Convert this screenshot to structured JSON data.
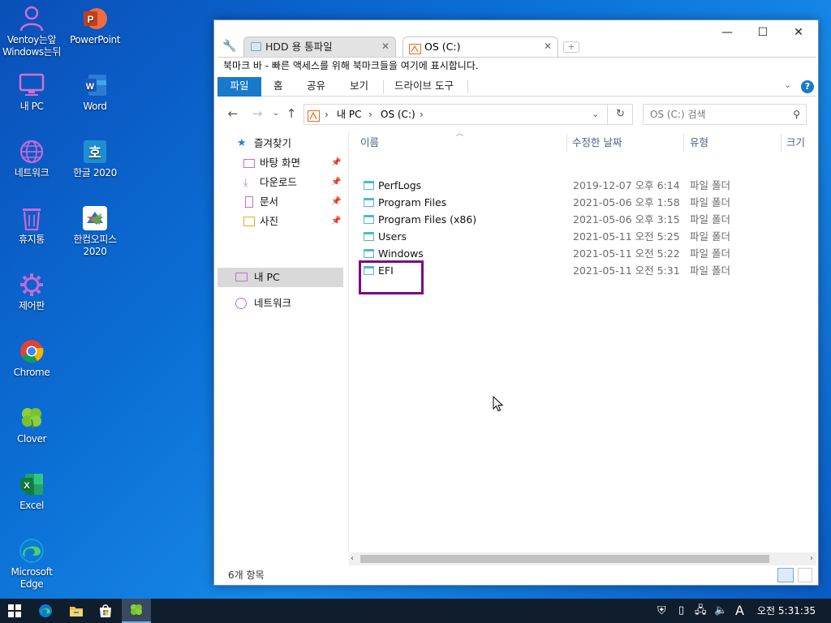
{
  "desktop": {
    "icons": [
      {
        "label": "Ventoy는앞\nWindows는뒤",
        "icon": "user-icon"
      },
      {
        "label": "PowerPoint",
        "icon": "powerpoint-icon"
      },
      {
        "label": "내 PC",
        "icon": "computer-icon"
      },
      {
        "label": "Word",
        "icon": "word-icon"
      },
      {
        "label": "네트워크",
        "icon": "network-icon"
      },
      {
        "label": "한글 2020",
        "icon": "hangul-icon"
      },
      {
        "label": "휴지통",
        "icon": "recycle-bin-icon"
      },
      {
        "label": "한컴오피스\n2020",
        "icon": "hancom-office-icon"
      },
      {
        "label": "제어판",
        "icon": "control-panel-icon"
      },
      {
        "label": "Chrome",
        "icon": "chrome-icon"
      },
      {
        "label": "Clover",
        "icon": "clover-icon"
      },
      {
        "label": "Excel",
        "icon": "excel-icon"
      },
      {
        "label": "Microsoft\nEdge",
        "icon": "edge-icon"
      }
    ]
  },
  "window": {
    "tabs": [
      {
        "label": "HDD 용 통파일",
        "active": false
      },
      {
        "label": "OS (C:)",
        "active": true
      }
    ],
    "controls": {
      "minimize": "—",
      "maximize": "☐",
      "close": "✕"
    },
    "bookmark_bar": "북마크 바 - 빠른 액세스를 위해 북마크들을 여기에 표시합니다.",
    "ribbon": {
      "tabs": [
        "파일",
        "홈",
        "공유",
        "보기",
        "드라이브 도구"
      ],
      "help": "?"
    },
    "address": {
      "crumbs": [
        "내 PC",
        "OS (C:)"
      ],
      "separator": "›",
      "search_placeholder": "OS (C:) 검색"
    },
    "nav_pane": {
      "quick_access": "즐겨찾기",
      "quick_items": [
        "바탕 화면",
        "다운로드",
        "문서",
        "사진"
      ],
      "this_pc": "내 PC",
      "network": "네트워크"
    },
    "columns": {
      "name": "이름",
      "date": "수정한 날짜",
      "type": "유형",
      "size": "크기"
    },
    "files": [
      {
        "name": "PerfLogs",
        "date": "2019-12-07 오후 6:14",
        "type": "파일 폴더"
      },
      {
        "name": "Program Files",
        "date": "2021-05-06 오후 1:58",
        "type": "파일 폴더"
      },
      {
        "name": "Program Files (x86)",
        "date": "2021-05-06 오후 3:15",
        "type": "파일 폴더"
      },
      {
        "name": "Users",
        "date": "2021-05-11 오전 5:25",
        "type": "파일 폴더"
      },
      {
        "name": "Windows",
        "date": "2021-05-11 오전 5:22",
        "type": "파일 폴더"
      },
      {
        "name": "EFI",
        "date": "2021-05-11 오전 5:31",
        "type": "파일 폴더"
      }
    ],
    "status": "6개 항목"
  },
  "taskbar": {
    "ime": "A",
    "clock": "오전 5:31:35"
  },
  "colors": {
    "accent": "#1979ca",
    "highlight_box": "#7a0d7e",
    "folder": "#4fb8d8"
  }
}
